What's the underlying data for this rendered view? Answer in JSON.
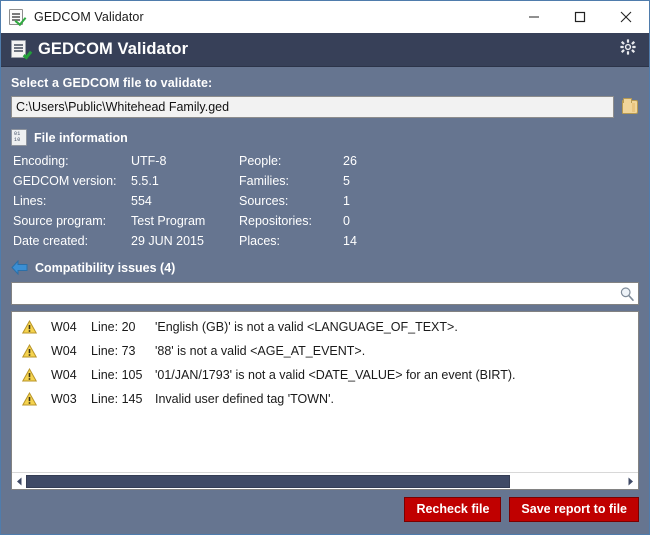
{
  "titlebar": {
    "title": "GEDCOM Validator",
    "icon": "document-check-icon",
    "minimize_label": "Minimize",
    "maximize_label": "Maximize",
    "close_label": "Close"
  },
  "header": {
    "title": "GEDCOM Validator",
    "icon": "document-check-icon",
    "settings_icon": "gear-icon",
    "background": "#374058"
  },
  "file_select": {
    "label": "Select a GEDCOM file to validate:",
    "path_value": "C:\\Users\\Public\\Whitehead Family.ged",
    "path_placeholder": "",
    "browse_icon": "folder-icon"
  },
  "file_information": {
    "heading": "File information",
    "icon": "binary-file-icon",
    "left": [
      {
        "label": "Encoding:",
        "value": "UTF-8"
      },
      {
        "label": "GEDCOM version:",
        "value": "5.5.1"
      },
      {
        "label": "Lines:",
        "value": "554"
      },
      {
        "label": "Source program:",
        "value": "Test Program"
      },
      {
        "label": "Date created:",
        "value": "29 JUN 2015"
      }
    ],
    "right": [
      {
        "label": "People:",
        "value": "26"
      },
      {
        "label": "Families:",
        "value": "5"
      },
      {
        "label": "Sources:",
        "value": "1"
      },
      {
        "label": "Repositories:",
        "value": "0"
      },
      {
        "label": "Places:",
        "value": "14"
      }
    ]
  },
  "issues": {
    "heading": "Compatibility issues (4)",
    "icon": "blue-arrow-left-icon",
    "search_value": "",
    "search_placeholder": "",
    "search_icon": "search-icon",
    "rows": [
      {
        "icon": "warning-icon",
        "code": "W04",
        "line": "Line: 20",
        "message": "'English (GB)' is not a valid <LANGUAGE_OF_TEXT>."
      },
      {
        "icon": "warning-icon",
        "code": "W04",
        "line": "Line: 73",
        "message": "'88' is not a valid <AGE_AT_EVENT>."
      },
      {
        "icon": "warning-icon",
        "code": "W04",
        "line": "Line: 105",
        "message": "'01/JAN/1793' is not a valid <DATE_VALUE> for an event (BIRT)."
      },
      {
        "icon": "warning-icon",
        "code": "W03",
        "line": "Line: 145",
        "message": "Invalid user defined tag 'TOWN'."
      }
    ],
    "scrollbar": {
      "left_arrow": "chevron-left-icon",
      "right_arrow": "chevron-right-icon",
      "thumb_percent": "81"
    }
  },
  "footer": {
    "recheck_label": "Recheck file",
    "save_label": "Save report to file",
    "button_color": "#c00000"
  }
}
